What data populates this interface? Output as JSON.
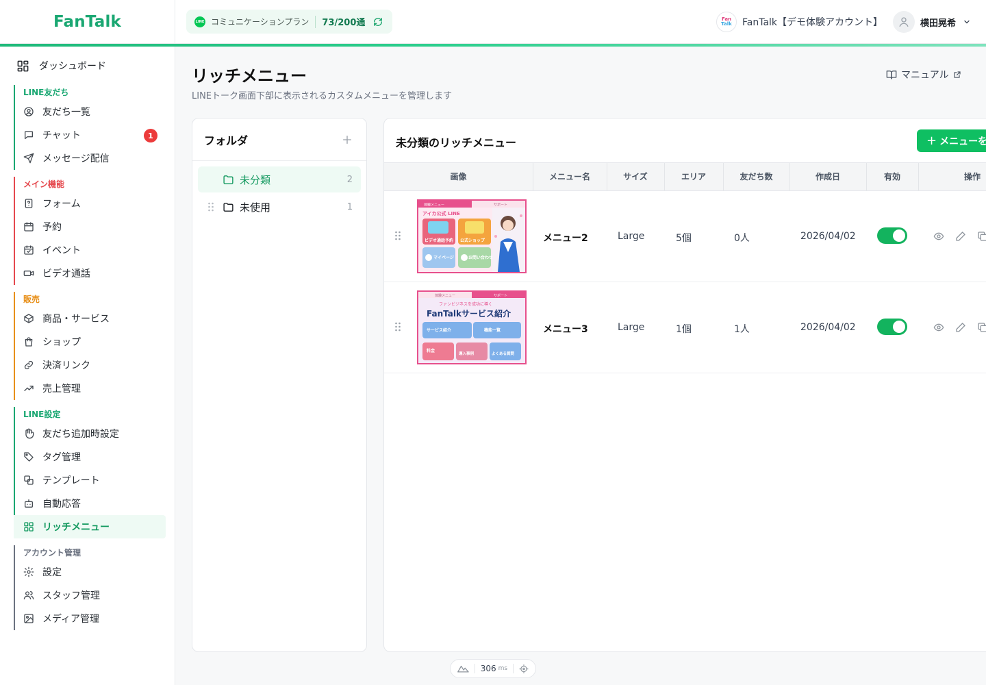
{
  "header": {
    "logo": "FanTalk",
    "plan_badge": "LINE",
    "plan_label": "コミュニケーションプラン",
    "plan_count": "73/200通",
    "account_logo_line1": "Fan",
    "account_logo_line2": "Talk",
    "account_name": "FanTalk【デモ体験アカウント】",
    "user_name": "横田晃希"
  },
  "sidebar": {
    "dashboard": "ダッシュボード",
    "groups": [
      {
        "title": "LINE友だち",
        "color": "#1aa772",
        "items": [
          {
            "label": "友だち一覧",
            "icon": "user-circle-icon"
          },
          {
            "label": "チャット",
            "icon": "chat-icon",
            "badge": "1"
          },
          {
            "label": "メッセージ配信",
            "icon": "send-icon"
          }
        ]
      },
      {
        "title": "メイン機能",
        "color": "#e5484d",
        "items": [
          {
            "label": "フォーム",
            "icon": "form-icon"
          },
          {
            "label": "予約",
            "icon": "calendar-icon"
          },
          {
            "label": "イベント",
            "icon": "calendar-check-icon"
          },
          {
            "label": "ビデオ通話",
            "icon": "video-icon"
          }
        ]
      },
      {
        "title": "販売",
        "color": "#e8901a",
        "items": [
          {
            "label": "商品・サービス",
            "icon": "box-icon"
          },
          {
            "label": "ショップ",
            "icon": "shopping-bag-icon"
          },
          {
            "label": "決済リンク",
            "icon": "link-icon"
          },
          {
            "label": "売上管理",
            "icon": "trending-up-icon"
          }
        ]
      },
      {
        "title": "LINE設定",
        "color": "#1aa772",
        "items": [
          {
            "label": "友だち追加時設定",
            "icon": "hand-icon"
          },
          {
            "label": "タグ管理",
            "icon": "tag-icon"
          },
          {
            "label": "テンプレート",
            "icon": "template-icon"
          },
          {
            "label": "自動応答",
            "icon": "bot-icon"
          },
          {
            "label": "リッチメニュー",
            "icon": "grid-icon",
            "active": true
          }
        ]
      },
      {
        "title": "アカウント管理",
        "color": "#6b7280",
        "items": [
          {
            "label": "設定",
            "icon": "gear-icon"
          },
          {
            "label": "スタッフ管理",
            "icon": "users-icon"
          },
          {
            "label": "メディア管理",
            "icon": "image-icon"
          }
        ]
      }
    ]
  },
  "page": {
    "title": "リッチメニュー",
    "subtitle": "LINEトーク画面下部に表示されるカスタムメニューを管理します",
    "manual_link": "マニュアル"
  },
  "folders": {
    "title": "フォルダ",
    "items": [
      {
        "name": "未分類",
        "count": "2",
        "selected": true
      },
      {
        "name": "未使用",
        "count": "1",
        "selected": false
      }
    ]
  },
  "menu_list": {
    "title": "未分類のリッチメニュー",
    "add_button": "メニューを",
    "columns": [
      "画像",
      "メニュー名",
      "サイズ",
      "エリア",
      "友だち数",
      "作成日",
      "有効",
      "操作"
    ],
    "rows": [
      {
        "name": "メニュー2",
        "size": "Large",
        "areas": "5個",
        "friends": "0人",
        "created": "2026/04/02",
        "enabled": true,
        "thumb": {
          "tab_left": "体験メニュー",
          "tab_right": "サポート",
          "heading": "アイカ公式 LINE",
          "btn1": "ビデオ通話予約",
          "btn2": "公式ショップ",
          "btn3": "マイページ",
          "btn4": "お問い合わせ"
        }
      },
      {
        "name": "メニュー3",
        "size": "Large",
        "areas": "1個",
        "friends": "1人",
        "created": "2026/04/02",
        "enabled": true,
        "thumb": {
          "tab_left": "体験メニュー",
          "tab_right": "サポート",
          "tagline": "ファンビジネスを成功に導く",
          "heading": "FanTalkサービス紹介",
          "btn1": "サービス紹介",
          "btn2": "機能一覧",
          "btn3": "料金",
          "btn4": "導入事例",
          "btn5": "よくある質問"
        }
      }
    ]
  },
  "perf": {
    "value": "306",
    "unit": "ms"
  }
}
